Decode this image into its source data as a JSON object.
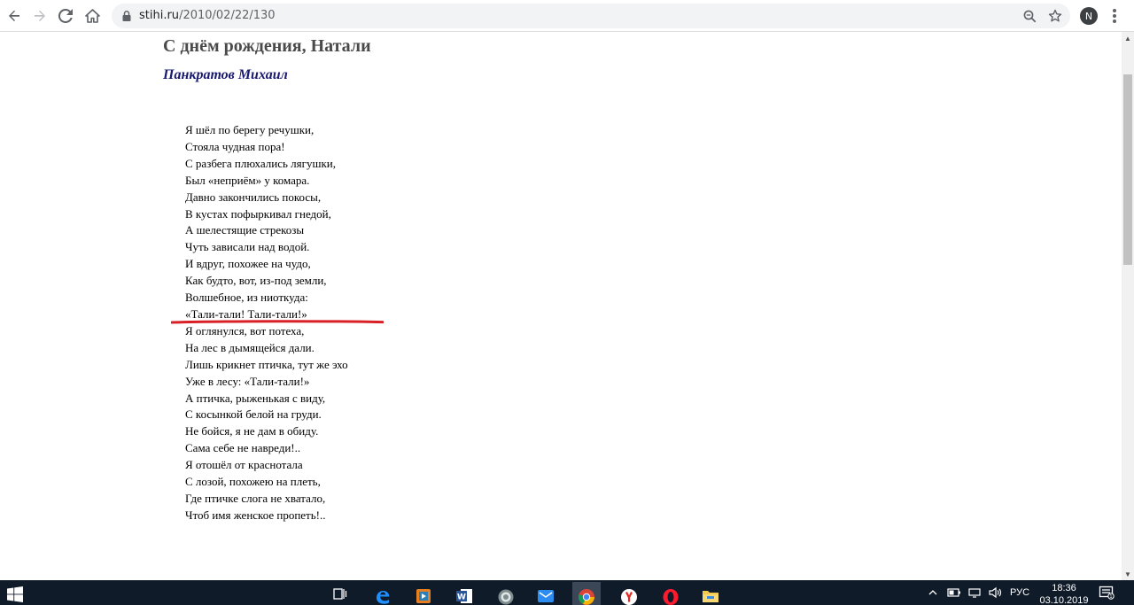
{
  "browser": {
    "url_domain": "stihi.ru",
    "url_path": "/2010/02/22/130",
    "profile_initial": "N",
    "back_icon": "arrow-left",
    "forward_icon": "arrow-right",
    "reload_icon": "reload",
    "home_icon": "home",
    "zoom_icon": "magnifier",
    "bookmark_icon": "star",
    "menu_icon": "vertical-dots"
  },
  "page": {
    "title": "С днём рождения, Натали",
    "author": "Панкратов Михаил",
    "lines": [
      "Я шёл по берегу речушки,",
      "Стояла чудная пора!",
      "С разбега плюхались лягушки,",
      "Был «неприём» у комара.",
      "Давно закончились покосы,",
      "В кустах пофыркивал гнедой,",
      "А шелестящие стрекозы",
      "Чуть зависали над водой.",
      "И вдруг, похожее на чудо,",
      "Как будто, вот, из-под земли,",
      "Волшебное, из ниоткуда:",
      "«Тали-тали! Тали-тали!»",
      "Я оглянулся, вот потеха,",
      "На лес в дымящейся дали.",
      "Лишь крикнет птичка, тут же эхо",
      "Уже в лесу: «Тали-тали!»",
      "А птичка, рыженькая с виду,",
      "С косынкой белой на груди.",
      "Не бойся, я не дам в обиду.",
      "Сама себе не навреди!..",
      "Я отошёл от краснотала",
      "С лозой, похожею на плеть,",
      "Где птичке слога не хватало,",
      "Чтоб имя женское пропеть!.."
    ],
    "highlight_color": "#d92027"
  },
  "taskbar": {
    "language": "РУС",
    "time": "18:36",
    "date": "03.10.2019",
    "accent_color": "#76b9ed"
  }
}
